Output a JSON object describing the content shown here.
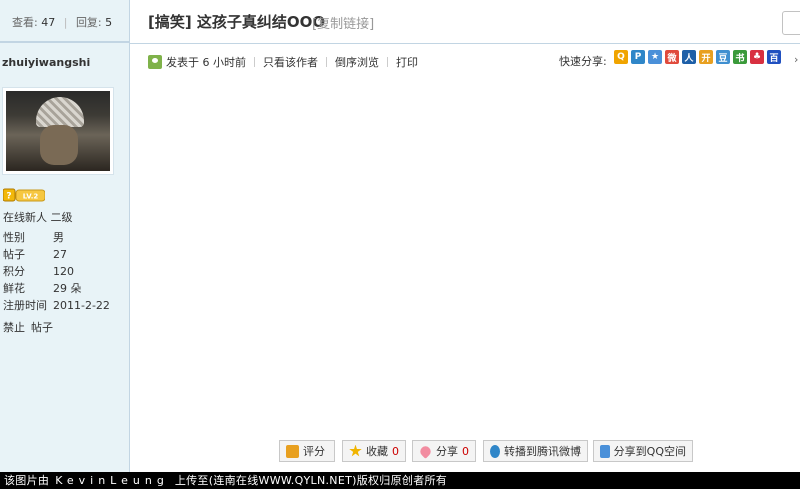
{
  "sidebar": {
    "views_label": "查看:",
    "views": "47",
    "replies_label": "回复:",
    "replies": "5",
    "username": "zhuiyiwangshi",
    "level_badge": "LV.2",
    "online_status": "在线新人 二级",
    "stats": [
      {
        "key": "性别",
        "value": "男"
      },
      {
        "key": "帖子",
        "value": "27"
      },
      {
        "key": "积分",
        "value": "120"
      },
      {
        "key": "鲜花",
        "value": "29 朵"
      },
      {
        "key": "注册时间",
        "value": "2011-2-22"
      }
    ],
    "ban_label": "禁止",
    "posts_link": "帖子"
  },
  "header": {
    "title": "[搞笑] 这孩子真纠结OOO",
    "copy_link": "[复制链接]"
  },
  "meta": {
    "posted": "发表于 6 小时前",
    "author_only": "只看该作者",
    "reverse": "倒序浏览",
    "print": "打印",
    "share_label": "快速分享:"
  },
  "share_icons": [
    {
      "name": "qzone-icon",
      "color": "#f0a400",
      "glyph": "Q"
    },
    {
      "name": "pengyou-icon",
      "color": "#2f86c8",
      "glyph": "P"
    },
    {
      "name": "favorite-star-icon",
      "color": "#4a90d9",
      "glyph": "★"
    },
    {
      "name": "weibo-icon",
      "color": "#e04a3c",
      "glyph": "微"
    },
    {
      "name": "renren-icon",
      "color": "#1d5fa8",
      "glyph": "人"
    },
    {
      "name": "kaixin-icon",
      "color": "#e8a020",
      "glyph": "开"
    },
    {
      "name": "douban-icon",
      "color": "#3f8fd0",
      "glyph": "豆"
    },
    {
      "name": "shuqian-icon",
      "color": "#3a9a3a",
      "glyph": "书"
    },
    {
      "name": "clover-icon",
      "color": "#d83040",
      "glyph": "♣"
    },
    {
      "name": "baidu-paw-icon",
      "color": "#2050c0",
      "glyph": "百"
    }
  ],
  "actions": {
    "rate": "评分",
    "favorite": "收藏",
    "favorite_count": "0",
    "share": "分享",
    "share_count": "0",
    "tencent_weibo": "转播到腾讯微博",
    "qq_zone": "分享到QQ空间"
  },
  "footer": {
    "prefix": "该图片由",
    "author": "KevinLeung",
    "middle": "上传至(",
    "site": "连南在线WWW.QYLN.NET",
    "suffix": ")版权归原创者所有"
  }
}
